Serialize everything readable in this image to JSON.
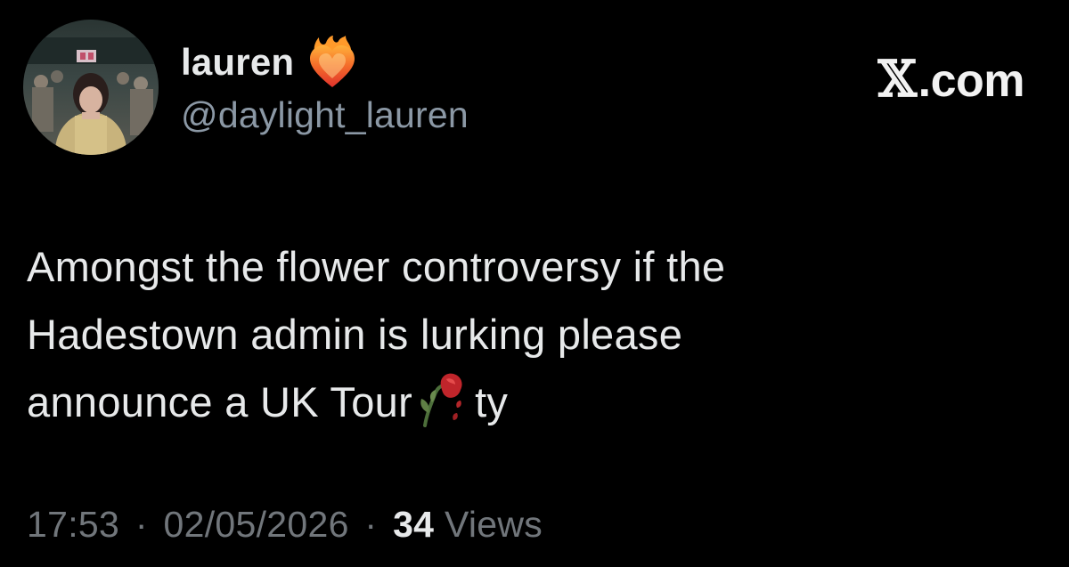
{
  "user": {
    "display_name": "lauren",
    "handle": "@daylight_lauren",
    "name_emoji": "heart-on-fire-icon",
    "avatar": "profile-photo-concert"
  },
  "brand": {
    "x_mark": "𝕏",
    "suffix": ".com"
  },
  "tweet": {
    "lines": [
      "Amongst the flower controversy if the",
      "Hadestown admin is lurking please",
      "announce a UK Tour"
    ],
    "trailing": "ty",
    "inline_emoji": "wilted-rose-icon"
  },
  "meta": {
    "time": "17:53",
    "date": "02/05/2026",
    "views_count": "34",
    "views_label": "Views",
    "separator": "·"
  },
  "colors": {
    "background": "#000000",
    "primary_text": "#e7e9ea",
    "secondary_text": "#71767b",
    "handle_text": "#8b98a5"
  }
}
